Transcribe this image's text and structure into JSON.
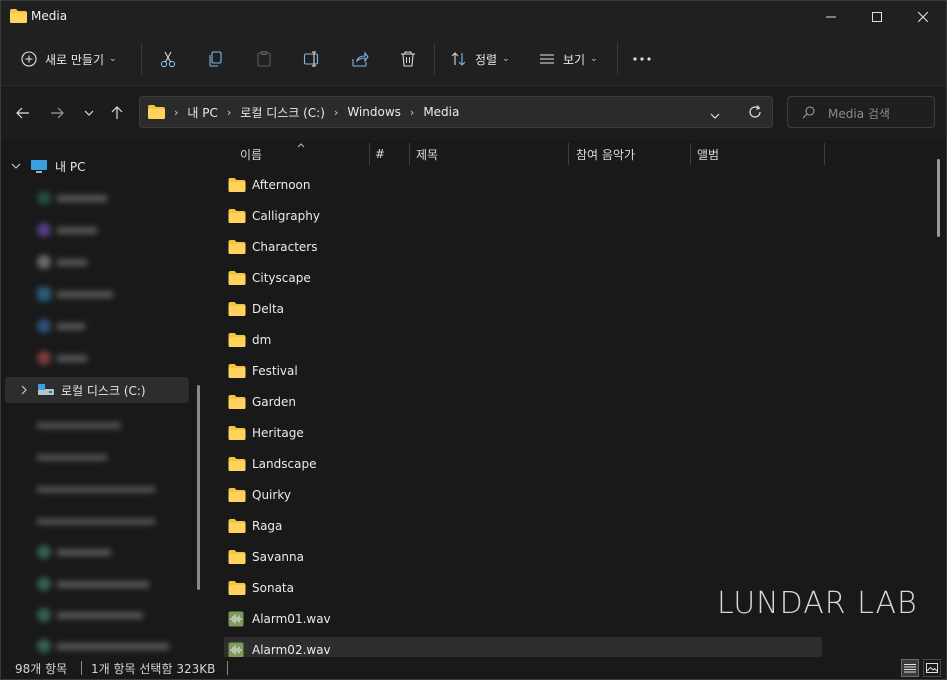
{
  "window": {
    "title": "Media"
  },
  "toolbar": {
    "new_label": "새로 만들기",
    "sort_label": "정렬",
    "view_label": "보기"
  },
  "address": {
    "crumbs": [
      "내 PC",
      "로컬 디스크 (C:)",
      "Windows",
      "Media"
    ]
  },
  "search": {
    "placeholder": "Media 검색"
  },
  "navpane": {
    "this_pc": "내 PC",
    "local_disk": "로컬 디스크 (C:)"
  },
  "columns": {
    "name": "이름",
    "number": "#",
    "title": "제목",
    "artist": "참여 음악가",
    "album": "앨범"
  },
  "files": [
    {
      "name": "Afternoon",
      "type": "folder"
    },
    {
      "name": "Calligraphy",
      "type": "folder"
    },
    {
      "name": "Characters",
      "type": "folder"
    },
    {
      "name": "Cityscape",
      "type": "folder"
    },
    {
      "name": "Delta",
      "type": "folder"
    },
    {
      "name": "dm",
      "type": "folder"
    },
    {
      "name": "Festival",
      "type": "folder"
    },
    {
      "name": "Garden",
      "type": "folder"
    },
    {
      "name": "Heritage",
      "type": "folder"
    },
    {
      "name": "Landscape",
      "type": "folder"
    },
    {
      "name": "Quirky",
      "type": "folder"
    },
    {
      "name": "Raga",
      "type": "folder"
    },
    {
      "name": "Savanna",
      "type": "folder"
    },
    {
      "name": "Sonata",
      "type": "folder"
    },
    {
      "name": "Alarm01.wav",
      "type": "audio"
    },
    {
      "name": "Alarm02.wav",
      "type": "audio",
      "selected": true
    }
  ],
  "watermark": "LUNDAR LAB",
  "status": {
    "item_count": "98개 항목",
    "selection": "1개 항목 선택함 323KB"
  },
  "colors": {
    "folder": "#f5c542",
    "accent_pc": "#3aa0e0",
    "audio_icon": "#7e9a5a"
  }
}
